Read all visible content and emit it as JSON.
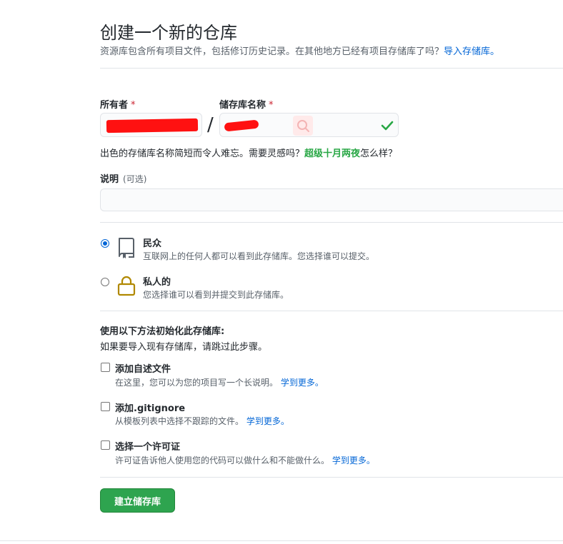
{
  "page": {
    "title": "创建一个新的仓库",
    "subtitle": "资源库包含所有项目文件，包括修订历史记录。在其他地方已经有项目存储库了吗？",
    "import_link": "导入存储库。"
  },
  "owner": {
    "label": "所有者",
    "required_mark": "*"
  },
  "repo": {
    "label": "储存库名称",
    "required_mark": "*",
    "separator": "/"
  },
  "hint": {
    "prefix": "出色的存储库名称简短而令人难忘。需要灵感吗？",
    "suggestion": "超级十月两夜",
    "suffix": "怎么样？"
  },
  "description": {
    "label": "说明",
    "optional": "(可选)",
    "value": ""
  },
  "visibility": {
    "public": {
      "title": "民众",
      "desc": "互联网上的任何人都可以看到此存储库。您选择谁可以提交。",
      "checked": true
    },
    "private": {
      "title": "私人的",
      "desc": "您选择谁可以看到并提交到此存储库。",
      "checked": false
    }
  },
  "init": {
    "title": "使用以下方法初始化此存储库:",
    "subtitle": "如果要导入现有存储库，请跳过此步骤。",
    "readme": {
      "title": "添加自述文件",
      "desc": "在这里，您可以为您的项目写一个长说明。",
      "link": "学到更多。"
    },
    "gitignore": {
      "title": "添加.gitignore",
      "desc": "从模板列表中选择不跟踪的文件。",
      "link": "学到更多。"
    },
    "license": {
      "title": "选择一个许可证",
      "desc": "许可证告诉他人使用您的代码可以做什么和不能做什么。",
      "link": "学到更多。"
    }
  },
  "submit": {
    "label": "建立储存库"
  },
  "colors": {
    "accent": "#2ea44f",
    "link": "#0366d6",
    "success": "#28a745",
    "required": "#cb2431",
    "redaction": "#ff1111"
  },
  "icons": {
    "public": "repo-icon",
    "private": "lock-icon",
    "valid": "check-icon"
  }
}
